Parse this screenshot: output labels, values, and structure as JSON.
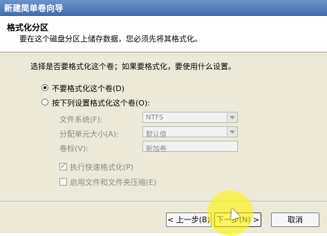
{
  "window": {
    "title": "新建简单卷向导"
  },
  "header": {
    "title": "格式化分区",
    "subtitle": "要在这个磁盘分区上储存数据，您必须先将其格式化。"
  },
  "main": {
    "prompt": "选择是否要格式化这个卷；如果要格式化，要使用什么设置。",
    "options": [
      {
        "label": "不要格式化这个卷(D)",
        "checked": true
      },
      {
        "label": "按下列设置格式化这个卷(O):",
        "checked": false
      }
    ],
    "fields": {
      "filesystem": {
        "label": "文件系统(F):",
        "value": "NTFS"
      },
      "allocation": {
        "label": "分配单元大小(A):",
        "value": "默认值"
      },
      "volume_label": {
        "label": "卷标(V):",
        "value": "新加卷"
      }
    },
    "checkboxes": [
      {
        "label": "执行快速格式化(P)",
        "checked": true
      },
      {
        "label": "启用文件和文件夹压缩(E)",
        "checked": false
      }
    ]
  },
  "footer": {
    "back": "< 上一步(B)",
    "next": "下一步(N) >",
    "cancel": "取消"
  }
}
